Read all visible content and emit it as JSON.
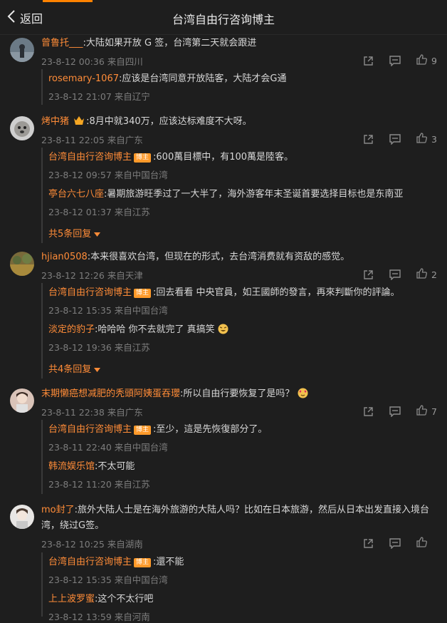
{
  "header": {
    "back_label": "返回",
    "title": "台湾自由行咨询博主"
  },
  "comments": [
    {
      "user": "曾鲁托___",
      "text": ":大陆如果开放 G 签，台湾第二天就会跟进",
      "meta": "23-8-12 00:36 来自四川",
      "likes": "9",
      "replies": [
        {
          "user": "rosemary-1067",
          "badge": "",
          "text": ":应该是台湾同意开放陆客，大陆才会G通",
          "meta": "23-8-12 21:07 来自辽宁"
        }
      ]
    },
    {
      "user": "烤中猪",
      "text": ":8月中就340万，应该达标难度不大呀。",
      "meta": "23-8-11 22:05 来自广东",
      "likes": "3",
      "replies": [
        {
          "user": "台湾自由行咨询博主",
          "badge": "博主",
          "text": ":600萬目標中，有100萬是陸客。",
          "meta": "23-8-12 09:57 来自中国台湾"
        },
        {
          "user": "亭台六七八座",
          "badge": "",
          "text": ":暑期旅游旺季过了一大半了，海外游客年末圣诞首要选择目标也是东南亚",
          "meta": "23-8-12 01:37 来自江苏"
        }
      ],
      "more": "共5条回复"
    },
    {
      "user": "hjian0508",
      "text": ":本来很喜欢台湾，但现在的形式，去台湾消费就有资敌的感觉。",
      "meta": "23-8-12 12:26 来自天津",
      "likes": "2",
      "replies": [
        {
          "user": "台湾自由行咨询博主",
          "badge": "博主",
          "text": ":回去看看 中央官員，如王國師的發言，再來判斷你的評論。",
          "meta": "23-8-12 15:35 来自中国台湾"
        },
        {
          "user": "淡定的豹子",
          "badge": "",
          "text": ":哈哈哈 你不去就完了 真搞笑",
          "meta": "23-8-12 19:36 来自江苏"
        }
      ],
      "more": "共4条回复"
    },
    {
      "user": "末期懒癌想减肥的秃頭阿姨蛋吞瓔",
      "text": ":所以自由行要恢复了是吗？",
      "meta": "23-8-11 22:38 来自广东",
      "likes": "7",
      "replies": [
        {
          "user": "台湾自由行咨询博主",
          "badge": "博主",
          "text": ":至少，這是先恢復部分了。",
          "meta": "23-8-11 22:40 来自中国台湾"
        },
        {
          "user": "韩流娱乐馆",
          "badge": "",
          "text": ":不太可能",
          "meta": "23-8-12 11:20 来自江苏"
        }
      ]
    },
    {
      "user": "mo封了",
      "text": ":旅外大陆人士是在海外旅游的大陆人吗？比如在日本旅游，然后从日本出发直接入境台湾，绕过G签。",
      "meta": "23-8-12 10:25 来自湖南",
      "likes": "",
      "replies": [
        {
          "user": "台湾自由行咨询博主",
          "badge": "博主",
          "text": ":還不能",
          "meta": "23-8-12 15:35 来自中国台湾"
        },
        {
          "user": "上上波罗蜜",
          "badge": "",
          "text": ":这个不太行吧",
          "meta": "23-8-12 13:59 来自河南"
        }
      ]
    }
  ],
  "icons": {
    "back": "chevron-left-icon",
    "share": "share-icon",
    "comment": "comment-icon",
    "like": "thumbs-up-icon"
  },
  "colors": {
    "accent": "#ff8200",
    "username": "#ff8c38",
    "badge": "#ff9a2a",
    "background": "#1e1e1e"
  }
}
